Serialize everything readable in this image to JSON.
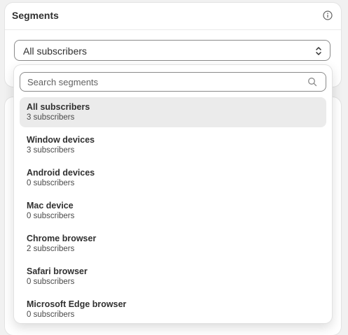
{
  "segments": {
    "title": "Segments",
    "selected_value": "All subscribers"
  },
  "dropdown": {
    "search_placeholder": "Search segments",
    "search_value": "",
    "items": [
      {
        "name": "All subscribers",
        "count": "3 subscribers",
        "selected": true
      },
      {
        "name": "Window devices",
        "count": "3 subscribers",
        "selected": false
      },
      {
        "name": "Android devices",
        "count": "0 subscribers",
        "selected": false
      },
      {
        "name": "Mac device",
        "count": "0 subscribers",
        "selected": false
      },
      {
        "name": "Chrome browser",
        "count": "2 subscribers",
        "selected": false
      },
      {
        "name": "Safari browser",
        "count": "0 subscribers",
        "selected": false
      },
      {
        "name": "Microsoft Edge browser",
        "count": "0 subscribers",
        "selected": false
      }
    ]
  },
  "icons": {
    "info": "info-icon",
    "chevron": "chevron-up-down-icon",
    "search": "search-icon"
  },
  "colors": {
    "selected_item_bg": "#ebebeb",
    "border": "#8a8a8a",
    "text": "#303030"
  }
}
